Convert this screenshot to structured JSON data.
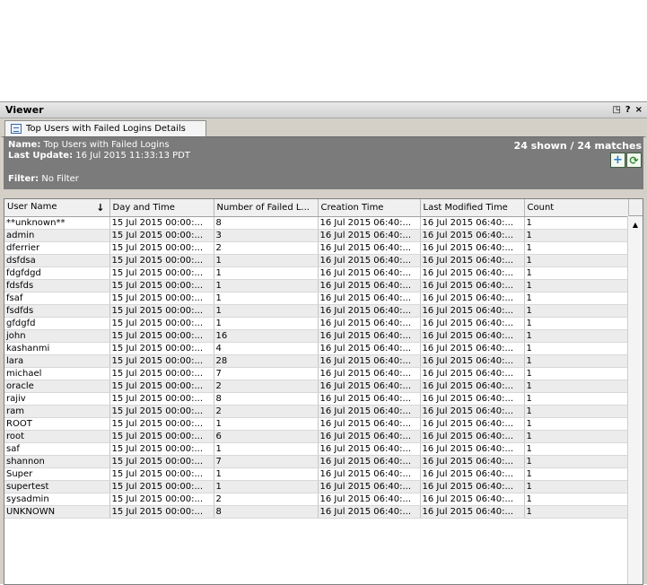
{
  "viewer": {
    "title": "Viewer",
    "controls": {
      "restore": "◳",
      "help": "?",
      "close": "×"
    }
  },
  "tab": {
    "label": "Top Users with Failed Logins Details",
    "icon": "report-icon"
  },
  "info": {
    "name_label": "Name:",
    "name_value": "Top Users with Failed Logins",
    "update_label": "Last Update:",
    "update_value": "16 Jul 2015 11:33:13 PDT",
    "filter_label": "Filter:",
    "filter_value": "No Filter",
    "matches": "24 shown / 24 matches",
    "add_icon": "+",
    "refresh_icon": "⟳"
  },
  "table": {
    "columns": [
      "User Name",
      "Day and Time",
      "Number of Failed L...",
      "Creation Time",
      "Last Modified Time",
      "Count"
    ],
    "sort_icon": "↓",
    "rows": [
      [
        "**unknown**",
        "15 Jul 2015 00:00:...",
        "8",
        "16 Jul 2015 06:40:...",
        "16 Jul 2015 06:40:...",
        "1"
      ],
      [
        "admin",
        "15 Jul 2015 00:00:...",
        "3",
        "16 Jul 2015 06:40:...",
        "16 Jul 2015 06:40:...",
        "1"
      ],
      [
        "dferrier",
        "15 Jul 2015 00:00:...",
        "2",
        "16 Jul 2015 06:40:...",
        "16 Jul 2015 06:40:...",
        "1"
      ],
      [
        "dsfdsa",
        "15 Jul 2015 00:00:...",
        "1",
        "16 Jul 2015 06:40:...",
        "16 Jul 2015 06:40:...",
        "1"
      ],
      [
        "fdgfdgd",
        "15 Jul 2015 00:00:...",
        "1",
        "16 Jul 2015 06:40:...",
        "16 Jul 2015 06:40:...",
        "1"
      ],
      [
        "fdsfds",
        "15 Jul 2015 00:00:...",
        "1",
        "16 Jul 2015 06:40:...",
        "16 Jul 2015 06:40:...",
        "1"
      ],
      [
        "fsaf",
        "15 Jul 2015 00:00:...",
        "1",
        "16 Jul 2015 06:40:...",
        "16 Jul 2015 06:40:...",
        "1"
      ],
      [
        "fsdfds",
        "15 Jul 2015 00:00:...",
        "1",
        "16 Jul 2015 06:40:...",
        "16 Jul 2015 06:40:...",
        "1"
      ],
      [
        "gfdgfd",
        "15 Jul 2015 00:00:...",
        "1",
        "16 Jul 2015 06:40:...",
        "16 Jul 2015 06:40:...",
        "1"
      ],
      [
        "john",
        "15 Jul 2015 00:00:...",
        "16",
        "16 Jul 2015 06:40:...",
        "16 Jul 2015 06:40:...",
        "1"
      ],
      [
        "kashanmi",
        "15 Jul 2015 00:00:...",
        "4",
        "16 Jul 2015 06:40:...",
        "16 Jul 2015 06:40:...",
        "1"
      ],
      [
        "lara",
        "15 Jul 2015 00:00:...",
        "28",
        "16 Jul 2015 06:40:...",
        "16 Jul 2015 06:40:...",
        "1"
      ],
      [
        "michael",
        "15 Jul 2015 00:00:...",
        "7",
        "16 Jul 2015 06:40:...",
        "16 Jul 2015 06:40:...",
        "1"
      ],
      [
        "oracle",
        "15 Jul 2015 00:00:...",
        "2",
        "16 Jul 2015 06:40:...",
        "16 Jul 2015 06:40:...",
        "1"
      ],
      [
        "rajiv",
        "15 Jul 2015 00:00:...",
        "8",
        "16 Jul 2015 06:40:...",
        "16 Jul 2015 06:40:...",
        "1"
      ],
      [
        "ram",
        "15 Jul 2015 00:00:...",
        "2",
        "16 Jul 2015 06:40:...",
        "16 Jul 2015 06:40:...",
        "1"
      ],
      [
        "ROOT",
        "15 Jul 2015 00:00:...",
        "1",
        "16 Jul 2015 06:40:...",
        "16 Jul 2015 06:40:...",
        "1"
      ],
      [
        "root",
        "15 Jul 2015 00:00:...",
        "6",
        "16 Jul 2015 06:40:...",
        "16 Jul 2015 06:40:...",
        "1"
      ],
      [
        "saf",
        "15 Jul 2015 00:00:...",
        "1",
        "16 Jul 2015 06:40:...",
        "16 Jul 2015 06:40:...",
        "1"
      ],
      [
        "shannon",
        "15 Jul 2015 00:00:...",
        "7",
        "16 Jul 2015 06:40:...",
        "16 Jul 2015 06:40:...",
        "1"
      ],
      [
        "Super",
        "15 Jul 2015 00:00:...",
        "1",
        "16 Jul 2015 06:40:...",
        "16 Jul 2015 06:40:...",
        "1"
      ],
      [
        "supertest",
        "15 Jul 2015 00:00:...",
        "1",
        "16 Jul 2015 06:40:...",
        "16 Jul 2015 06:40:...",
        "1"
      ],
      [
        "sysadmin",
        "15 Jul 2015 00:00:...",
        "2",
        "16 Jul 2015 06:40:...",
        "16 Jul 2015 06:40:...",
        "1"
      ],
      [
        "UNKNOWN",
        "15 Jul 2015 00:00:...",
        "8",
        "16 Jul 2015 06:40:...",
        "16 Jul 2015 06:40:...",
        "1"
      ]
    ]
  },
  "scrollbar": {
    "up_icon": "▲"
  }
}
